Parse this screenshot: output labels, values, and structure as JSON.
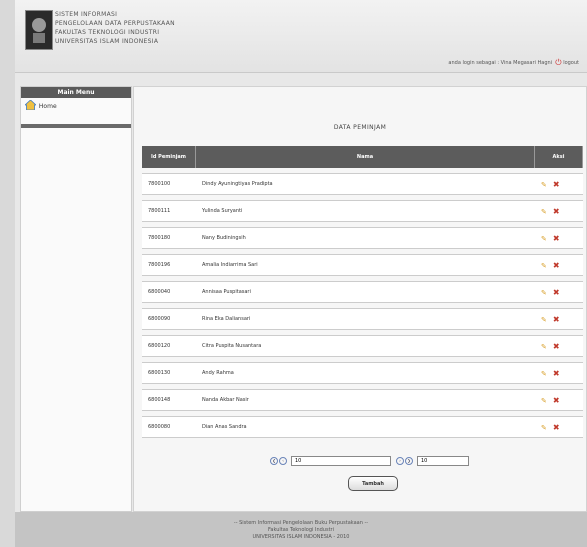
{
  "header": {
    "lines": [
      "SISTEM INFORMASI",
      "PENGELOLAAN DATA PERPUSTAKAAN",
      "FAKULTAS TEKNOLOGI INDUSTRI",
      "UNIVERSITAS ISLAM INDONESIA"
    ],
    "login_text": "anda login sebagai : Vina Megasari Hagni",
    "logout_label": "logout"
  },
  "sidebar": {
    "title": "Main Menu",
    "items": [
      {
        "label": "Home",
        "icon": "home-icon"
      }
    ]
  },
  "main": {
    "title": "DATA PEMINJAM",
    "table": {
      "headers": [
        "Id Peminjam",
        "Nama",
        "Aksi"
      ],
      "rows": [
        {
          "id": "7800100",
          "nama": "Dindy Ayuningtiyas Pradipta"
        },
        {
          "id": "7800111",
          "nama": "Yulinda Suryanti"
        },
        {
          "id": "7800180",
          "nama": "Nany Budiningsih"
        },
        {
          "id": "7800196",
          "nama": "Amalia Indiarrima Sari"
        },
        {
          "id": "6800040",
          "nama": "Annisaa Puspitasari"
        },
        {
          "id": "6800090",
          "nama": "Rina Eka Daliansari"
        },
        {
          "id": "6800120",
          "nama": "Citra Puspita Nusantara"
        },
        {
          "id": "6800130",
          "nama": "Andy Rahma"
        },
        {
          "id": "6800148",
          "nama": "Nanda Akbar Nasir"
        },
        {
          "id": "6800080",
          "nama": "Dian Anas Sandra"
        }
      ]
    },
    "pager": {
      "page_value": "10",
      "limit_value": "10"
    },
    "add_button": "Tambah"
  },
  "footer": {
    "lines": [
      "-- Sistem Informasi Pengelolaan Buku Perpustakaan --",
      "Fakultas Teknologi Industri",
      "UNIVERSITAS ISLAM INDONESIA - 2010"
    ]
  }
}
